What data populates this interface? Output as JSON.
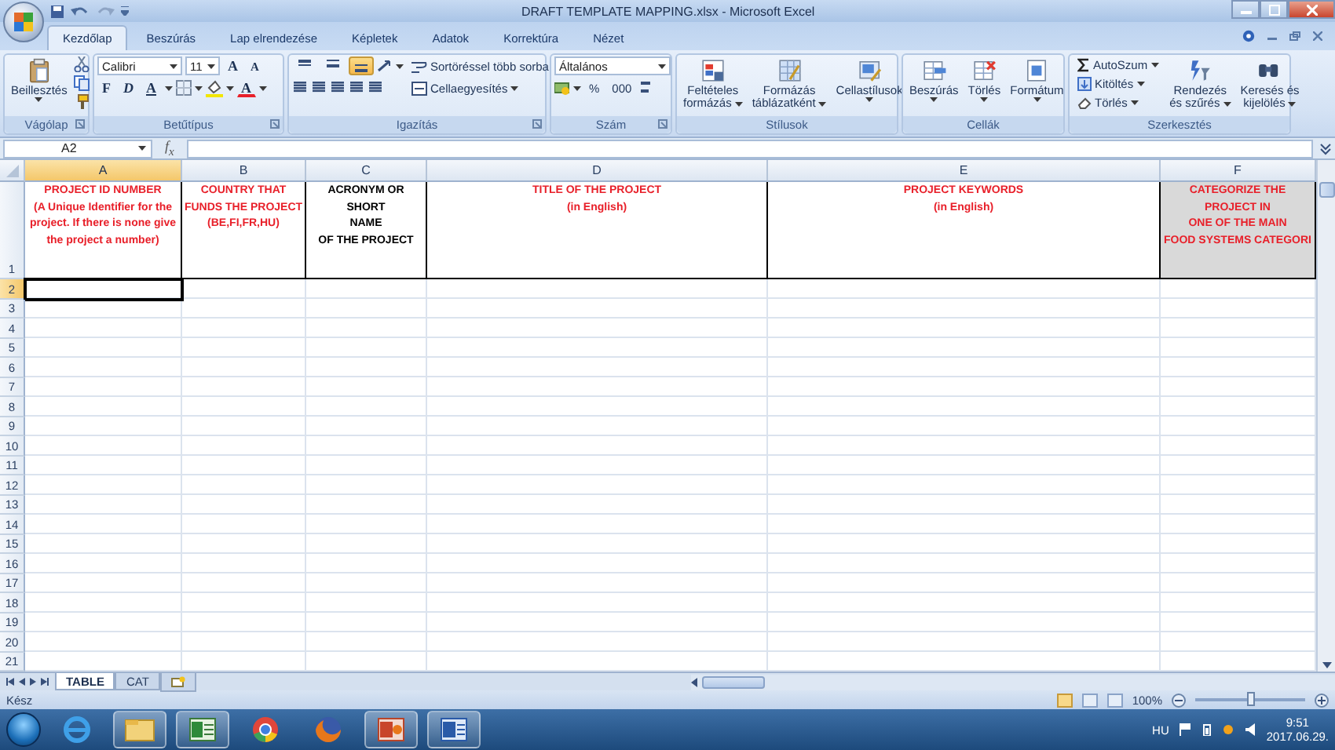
{
  "window": {
    "title": "DRAFT TEMPLATE MAPPING.xlsx - Microsoft Excel"
  },
  "tabs": [
    {
      "label": "Kezdőlap",
      "selected": true
    },
    {
      "label": "Beszúrás",
      "selected": false
    },
    {
      "label": "Lap elrendezése",
      "selected": false
    },
    {
      "label": "Képletek",
      "selected": false
    },
    {
      "label": "Adatok",
      "selected": false
    },
    {
      "label": "Korrektúra",
      "selected": false
    },
    {
      "label": "Nézet",
      "selected": false
    }
  ],
  "ribbon": {
    "clipboard": {
      "label": "Vágólap",
      "paste": "Beillesztés"
    },
    "font": {
      "label": "Betűtípus",
      "font_name": "Calibri",
      "font_size": "11",
      "grow": "A",
      "shrink": "A",
      "bold": "F",
      "italic": "D",
      "underline": "A",
      "font_color": "A"
    },
    "alignment": {
      "label": "Igazítás",
      "vertical": [
        {
          "selected": false
        },
        {
          "selected": false
        },
        {
          "selected": true
        }
      ],
      "wrap_text": "Sortöréssel több sorba",
      "merge": "Cellaegyesítés"
    },
    "number": {
      "label": "Szám",
      "format": "Általános",
      "percent": "%",
      "thousands": "000"
    },
    "styles": {
      "label": "Stílusok",
      "buttons": [
        {
          "lines": [
            "Feltételes",
            "formázás"
          ]
        },
        {
          "lines": [
            "Formázás",
            "táblázatként"
          ]
        },
        {
          "lines": [
            "Cellastílusok"
          ]
        }
      ]
    },
    "cells": {
      "label": "Cellák",
      "buttons": [
        {
          "lines": [
            "Beszúrás"
          ]
        },
        {
          "lines": [
            "Törlés"
          ]
        },
        {
          "lines": [
            "Formátum"
          ]
        }
      ]
    },
    "editing": {
      "label": "Szerkesztés",
      "small": [
        "AutoSzum",
        "Kitöltés",
        "Törlés"
      ],
      "buttons": [
        {
          "lines": [
            "Rendezés",
            "és szűrés"
          ]
        },
        {
          "lines": [
            "Keresés és",
            "kijelölés"
          ]
        }
      ]
    }
  },
  "formula_bar": {
    "name_box": "A2",
    "fx": "f$_{x}$"
  },
  "sheet": {
    "columns": [
      {
        "label": "A",
        "selected": true
      },
      {
        "label": "B",
        "selected": false
      },
      {
        "label": "C",
        "selected": false
      },
      {
        "label": "D",
        "selected": false
      },
      {
        "label": "E",
        "selected": false
      },
      {
        "label": "F",
        "selected": false
      }
    ],
    "header_cells": [
      {
        "text": "PROJECT ID NUMBER\n(A Unique Identifier for the project.  If there is none give the project a number)",
        "color": "#e8202a",
        "shaded": false
      },
      {
        "text": "COUNTRY THAT\nFUNDS THE PROJECT\n(BE,FI,FR,HU)",
        "color": "#e8202a",
        "shaded": false
      },
      {
        "text": "ACRONYM OR SHORT\nNAME\nOF THE PROJECT",
        "color": "#000000",
        "shaded": false
      },
      {
        "text": "TITLE OF THE PROJECT\n(in English)",
        "color": "#e8202a",
        "shaded": false
      },
      {
        "text": "PROJECT KEYWORDS\n(in English)",
        "color": "#e8202a",
        "shaded": false
      },
      {
        "text": "CATEGORIZE THE PROJECT IN\nONE OF THE MAIN\nFOOD SYSTEMS CATEGORI",
        "color": "#e8202a",
        "shaded": true
      }
    ],
    "rows": [
      {
        "label": "1",
        "selected": false
      },
      {
        "label": "2",
        "selected": true
      },
      {
        "label": "3",
        "selected": false
      },
      {
        "label": "4",
        "selected": false
      },
      {
        "label": "5",
        "selected": false
      },
      {
        "label": "6",
        "selected": false
      },
      {
        "label": "7",
        "selected": false
      },
      {
        "label": "8",
        "selected": false
      },
      {
        "label": "9",
        "selected": false
      },
      {
        "label": "10",
        "selected": false
      },
      {
        "label": "11",
        "selected": false
      },
      {
        "label": "12",
        "selected": false
      },
      {
        "label": "13",
        "selected": false
      },
      {
        "label": "14",
        "selected": false
      },
      {
        "label": "15",
        "selected": false
      },
      {
        "label": "16",
        "selected": false
      },
      {
        "label": "17",
        "selected": false
      },
      {
        "label": "18",
        "selected": false
      },
      {
        "label": "19",
        "selected": false
      },
      {
        "label": "20",
        "selected": false
      },
      {
        "label": "21",
        "selected": false
      }
    ]
  },
  "sheet_tabs": [
    {
      "label": "TABLE",
      "selected": true
    },
    {
      "label": "CAT",
      "selected": false
    }
  ],
  "status_bar": {
    "status": "Kész",
    "views": [
      {
        "selected": true
      },
      {
        "selected": false
      },
      {
        "selected": false
      }
    ],
    "zoom": "100%",
    "zoom_slider": {
      "level": 0.5
    }
  },
  "taskbar": {
    "apps": [
      {
        "open": false
      },
      {
        "open": true
      },
      {
        "open": true
      },
      {
        "open": false
      },
      {
        "open": false
      },
      {
        "open": true
      },
      {
        "open": true
      }
    ],
    "language": "HU",
    "time": "9:51",
    "date": "2017.06.29."
  }
}
